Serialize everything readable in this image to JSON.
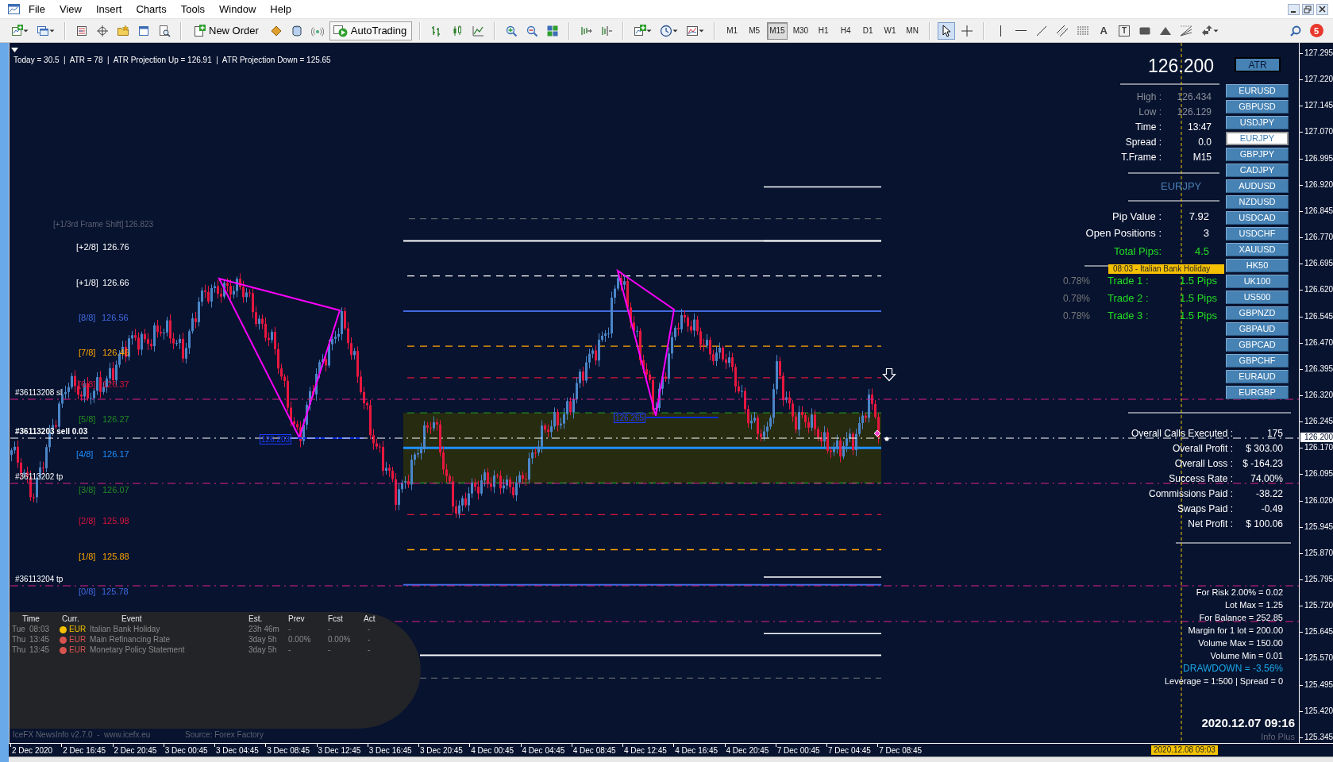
{
  "menu": [
    "File",
    "View",
    "Insert",
    "Charts",
    "Tools",
    "Window",
    "Help"
  ],
  "toolbar": {
    "new_order": "New Order",
    "autotrading": {
      "label": "AutoTrading",
      "on": true
    },
    "timeframes": [
      {
        "label": "M1",
        "selected": false
      },
      {
        "label": "M5",
        "selected": false
      },
      {
        "label": "M15",
        "selected": true
      },
      {
        "label": "M30",
        "selected": false
      },
      {
        "label": "H1",
        "selected": false
      },
      {
        "label": "H4",
        "selected": false
      },
      {
        "label": "D1",
        "selected": false
      },
      {
        "label": "W1",
        "selected": false
      },
      {
        "label": "MN",
        "selected": false
      }
    ],
    "drawing_tools": [
      {
        "selected": true
      },
      {
        "selected": false
      },
      {
        "selected": false
      },
      {
        "selected": false
      },
      {
        "selected": false
      },
      {
        "selected": false
      },
      {
        "selected": false
      },
      {
        "glyph": "A",
        "selected": false
      },
      {
        "glyph": "T",
        "selected": false
      },
      {
        "selected": false
      },
      {
        "selected": false
      },
      {
        "selected": false
      },
      {
        "selected": false
      }
    ],
    "notifications": "5"
  },
  "chart": {
    "info_line": "Today = 30.5  |  ATR = 78  |  ATR Projection Up = 126.91  |  ATR Projection Down = 125.65",
    "frame_shift": {
      "label": "[+1/3rd Frame Shift]",
      "value": "126.823"
    },
    "murrey_levels": [
      {
        "label": "[+2/8]",
        "value": "126.76",
        "color": "#ffffff"
      },
      {
        "label": "[+1/8]",
        "value": "126.66",
        "color": "#ffffff"
      },
      {
        "label": "[8/8]",
        "value": "126.56",
        "color": "#4169e1"
      },
      {
        "label": "[7/8]",
        "value": "126.46",
        "color": "#ffa500"
      },
      {
        "label": "[6/8]",
        "value": "126.37",
        "color": "#dc143c"
      },
      {
        "label": "[5/8]",
        "value": "126.27",
        "color": "#228b22"
      },
      {
        "label": "[4/8]",
        "value": "126.17",
        "color": "#1e90ff"
      },
      {
        "label": "[3/8]",
        "value": "126.07",
        "color": "#228b22"
      },
      {
        "label": "[2/8]",
        "value": "125.98",
        "color": "#dc143c"
      },
      {
        "label": "[1/8]",
        "value": "125.88",
        "color": "#ffa500"
      },
      {
        "label": "[0/8]",
        "value": "125.78",
        "color": "#4169e1"
      }
    ],
    "order_lines": [
      {
        "label": "#36113208 sl",
        "kind": "stoploss"
      },
      {
        "label": "#36113203 sell 0.03",
        "kind": "position"
      },
      {
        "label": "#36113202 tp",
        "kind": "takeprofit"
      },
      {
        "label": "#36113204 tp",
        "kind": "takeprofit"
      }
    ],
    "pattern_labels": [
      "126.203",
      "126.265"
    ],
    "news_marker": "08:03 - Italian Bank Holiday"
  },
  "price_axis": {
    "labels": [
      "127.295",
      "127.220",
      "127.145",
      "127.070",
      "126.995",
      "126.920",
      "126.845",
      "126.770",
      "126.695",
      "126.620",
      "126.545",
      "126.470",
      "126.395",
      "126.320",
      "126.245",
      "126.170",
      "126.095",
      "126.020",
      "125.945",
      "125.870",
      "125.795",
      "125.720",
      "125.645",
      "125.570",
      "125.495",
      "125.420",
      "125.345"
    ],
    "current": "126.200"
  },
  "time_axis": {
    "labels": [
      "2 Dec 2020",
      "2 Dec 16:45",
      "2 Dec 20:45",
      "3 Dec 00:45",
      "3 Dec 04:45",
      "3 Dec 08:45",
      "3 Dec 12:45",
      "3 Dec 16:45",
      "3 Dec 20:45",
      "4 Dec 00:45",
      "4 Dec 04:45",
      "4 Dec 08:45",
      "4 Dec 12:45",
      "4 Dec 16:45",
      "4 Dec 20:45",
      "7 Dec 00:45",
      "7 Dec 04:45",
      "7 Dec 08:45"
    ],
    "cursor_time": "2020.12.08 09:03"
  },
  "info_panel": {
    "price": "126.200",
    "rows": [
      {
        "label": "High :",
        "value": "126.434",
        "dim": true
      },
      {
        "label": "Low :",
        "value": "126.129",
        "dim": true
      },
      {
        "label": "Time :",
        "value": "13:47",
        "dim": false
      },
      {
        "label": "Spread :",
        "value": "0.0",
        "dim": false
      },
      {
        "label": "T.Frame :",
        "value": "M15",
        "dim": false
      }
    ],
    "symbol": "EURJPY",
    "stats": [
      {
        "label": "Pip Value :",
        "value": "7.92",
        "highlight": false
      },
      {
        "label": "Open Positions :",
        "value": "3",
        "highlight": false
      },
      {
        "label": "Total Pips:",
        "value": "4.5",
        "highlight": true
      }
    ],
    "trades": [
      {
        "percent": "0.78%",
        "label": "Trade 1 :",
        "value": "1.5 Pips"
      },
      {
        "percent": "0.78%",
        "label": "Trade 2 :",
        "value": "1.5 Pips"
      },
      {
        "percent": "0.78%",
        "label": "Trade 3 :",
        "value": "1.5 Pips"
      }
    ]
  },
  "atr_button": "ATR",
  "symbol_buttons": [
    {
      "label": "EURUSD",
      "selected": false
    },
    {
      "label": "GBPUSD",
      "selected": false
    },
    {
      "label": "USDJPY",
      "selected": false
    },
    {
      "label": "EURJPY",
      "selected": true
    },
    {
      "label": "GBPJPY",
      "selected": false
    },
    {
      "label": "CADJPY",
      "selected": false
    },
    {
      "label": "AUDUSD",
      "selected": false
    },
    {
      "label": "NZDUSD",
      "selected": false
    },
    {
      "label": "USDCAD",
      "selected": false
    },
    {
      "label": "USDCHF",
      "selected": false
    },
    {
      "label": "XAUUSD",
      "selected": false
    },
    {
      "label": "HK50",
      "selected": false
    },
    {
      "label": "UK100",
      "selected": false
    },
    {
      "label": "US500",
      "selected": false
    },
    {
      "label": "GBPNZD",
      "selected": false
    },
    {
      "label": "GBPAUD",
      "selected": false
    },
    {
      "label": "GBPCAD",
      "selected": false
    },
    {
      "label": "GBPCHF",
      "selected": false
    },
    {
      "label": "EURAUD",
      "selected": false
    },
    {
      "label": "EURGBP",
      "selected": false
    }
  ],
  "account_stats": [
    {
      "label": "Overall Calls Executed :",
      "value": "175"
    },
    {
      "label": "Overall Profit :",
      "value": "$ 303.00"
    },
    {
      "label": "Overall Loss :",
      "value": "$ -164.23"
    },
    {
      "label": "Success Rate :",
      "value": "74.00%"
    },
    {
      "label": "Commissions Paid :",
      "value": "-38.22"
    },
    {
      "label": "Swaps Paid :",
      "value": "-0.49"
    },
    {
      "label": "Net Profit :",
      "value": "$ 100.06"
    }
  ],
  "risk_panel": [
    {
      "text": "For Risk 2.00% = 0.02",
      "kind": "normal"
    },
    {
      "text": "Lot Max = 1.25",
      "kind": "normal"
    },
    {
      "text": "For Balance = 252.85",
      "kind": "normal"
    },
    {
      "text": "Margin for 1 lot = 200.00",
      "kind": "normal"
    },
    {
      "text": "Volume Max = 150.00",
      "kind": "normal"
    },
    {
      "text": "Volume Min = 0.01",
      "kind": "normal"
    },
    {
      "text": "DRAWDOWN = -3.56%",
      "kind": "alert"
    },
    {
      "text": "Leverage = 1:500 | Spread = 0",
      "kind": "normal"
    }
  ],
  "clock": "2020.12.07 09:16",
  "brand": "Info Plus",
  "news_panel": {
    "columns": [
      "Time",
      "Curr.",
      "Event",
      "Est.",
      "Prev",
      "Fcst",
      "Act"
    ],
    "rows": [
      {
        "day": "Tue",
        "time": "08:03",
        "currency": "EUR",
        "color": "#f5c000",
        "event": "Italian Bank Holiday",
        "est": "23h 46m",
        "prev": "-",
        "fcst": "-",
        "act": "-"
      },
      {
        "day": "Thu",
        "time": "13:45",
        "currency": "EUR",
        "color": "#d9534f",
        "event": "Main Refinancing Rate",
        "est": "3day 5h",
        "prev": "0.00%",
        "fcst": "0.00%",
        "act": "-"
      },
      {
        "day": "Thu",
        "time": "13:45",
        "currency": "EUR",
        "color": "#d9534f",
        "event": "Monetary Policy Statement",
        "est": "3day 5h",
        "prev": "-",
        "fcst": "-",
        "act": "-"
      }
    ],
    "footer": "IceFX NewsInfo v2.7.0  -  www.icefx.eu",
    "source": "Source: Forex Factory"
  }
}
